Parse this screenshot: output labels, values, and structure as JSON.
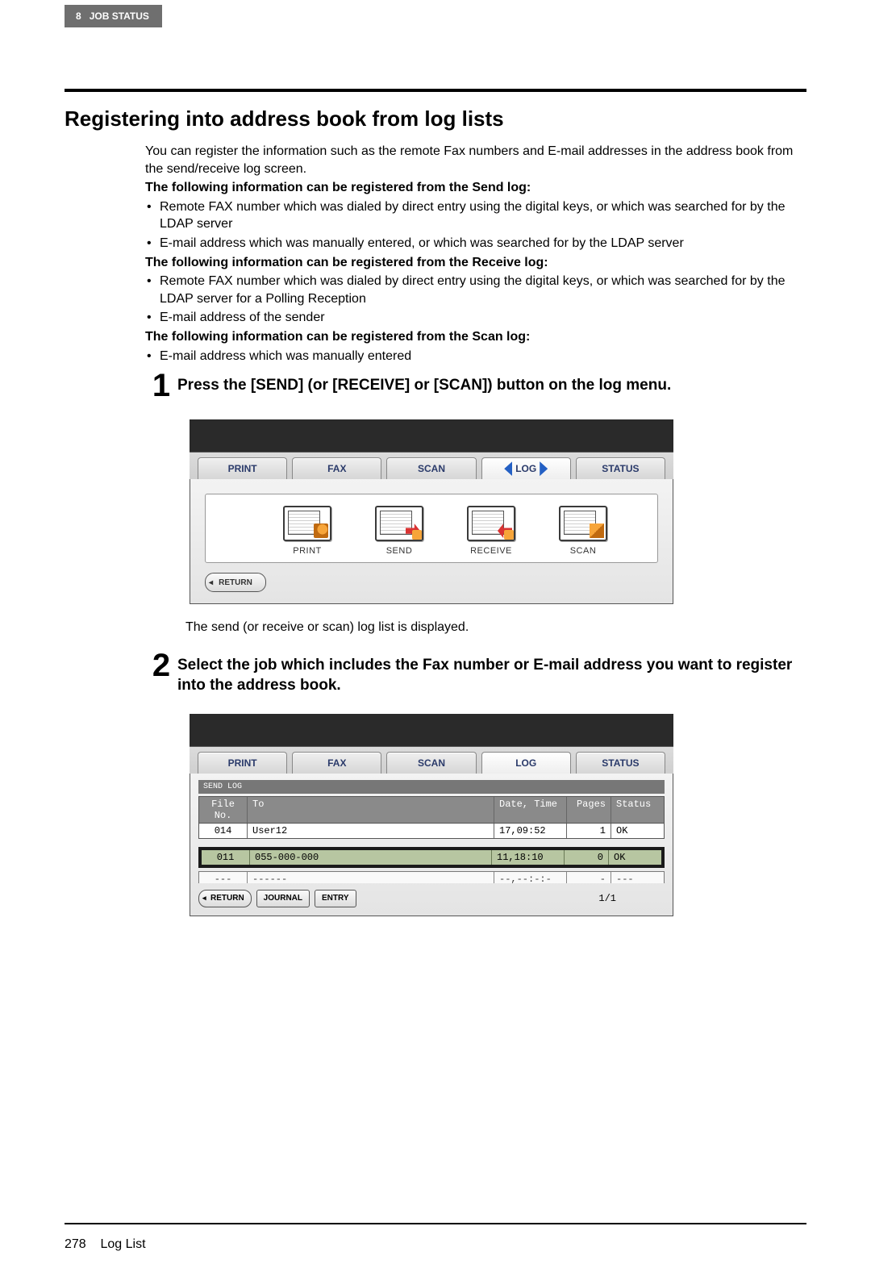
{
  "header": {
    "chapter_number": "8",
    "chapter_title": "JOB STATUS"
  },
  "section_title": "Registering into address book from log lists",
  "intro_para": "You can register the information such as the remote Fax numbers and E-mail addresses in the address book from the send/receive log screen.",
  "send_info_heading": "The following information can be registered from the Send log:",
  "send_info_bullets": [
    "Remote FAX number which was dialed by direct entry using the digital keys, or which was searched for by the LDAP server",
    "E-mail address which was manually entered, or which was searched for by the LDAP server"
  ],
  "receive_info_heading": "The following information can be registered from the Receive log:",
  "receive_info_bullets": [
    "Remote FAX number which was dialed by direct entry using the digital keys, or which was searched for by the LDAP server for a Polling Reception",
    "E-mail address of the sender"
  ],
  "scan_info_heading": "The following information can be registered from the Scan log:",
  "scan_info_bullets": [
    "E-mail address which was manually entered"
  ],
  "step1": {
    "num": "1",
    "title": "Press the [SEND] (or [RECEIVE] or [SCAN]) button on the log menu.",
    "tabs": {
      "print": "PRINT",
      "fax": "FAX",
      "scan": "SCAN",
      "log": "LOG",
      "status": "STATUS"
    },
    "log_buttons": {
      "print": "PRINT",
      "send": "SEND",
      "receive": "RECEIVE",
      "scan": "SCAN"
    },
    "return": "RETURN",
    "after": "The send (or receive or scan) log list is displayed."
  },
  "step2": {
    "num": "2",
    "title": "Select the job which includes the Fax number or E-mail address you want to register into the address book.",
    "tabs": {
      "print": "PRINT",
      "fax": "FAX",
      "scan": "SCAN",
      "log": "LOG",
      "status": "STATUS"
    },
    "strip": "SEND LOG",
    "columns": {
      "file": "File No.",
      "to": "To",
      "dt": "Date, Time",
      "pages": "Pages",
      "status": "Status"
    },
    "rows": [
      {
        "file": "014",
        "to": "User12",
        "dt": "17,09:52",
        "pages": "1",
        "status": "OK"
      }
    ],
    "highlight_row": {
      "file": "011",
      "to": "055-000-000",
      "dt": "11,18:10",
      "pages": "0",
      "status": "OK"
    },
    "partial_row": {
      "file": "---",
      "to": "------",
      "dt": "--,--:-:-",
      "pages": "-",
      "status": "---"
    },
    "buttons": {
      "return": "RETURN",
      "journal": "JOURNAL",
      "entry": "ENTRY"
    },
    "page_counter": "1/1"
  },
  "footer": {
    "page_number": "278",
    "section": "Log List"
  }
}
